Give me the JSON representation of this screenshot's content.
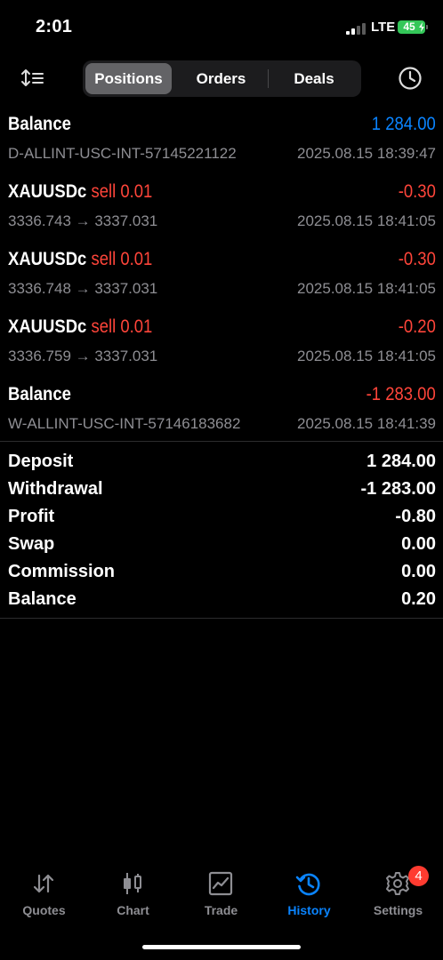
{
  "status_bar": {
    "time": "2:01",
    "network": "LTE",
    "battery": "45"
  },
  "tabs_top": [
    "Positions",
    "Orders",
    "Deals"
  ],
  "active_top_tab": "Positions",
  "deals": [
    {
      "l1": "Balance",
      "r1": "1 284.00",
      "l2": "D-ALLINT-USC-INT-57145221122",
      "r2": "2025.08.15 18:39:47",
      "kind": "balance",
      "color": "#0a84ff"
    },
    {
      "symbol": "XAUUSDc",
      "side": "sell 0.01",
      "r1": "-0.30",
      "l2": "3336.743 → 3337.031",
      "r2": "2025.08.15 18:41:05",
      "kind": "trade"
    },
    {
      "symbol": "XAUUSDc",
      "side": "sell 0.01",
      "r1": "-0.30",
      "l2": "3336.748 → 3337.031",
      "r2": "2025.08.15 18:41:05",
      "kind": "trade"
    },
    {
      "symbol": "XAUUSDc",
      "side": "sell 0.01",
      "r1": "-0.20",
      "l2": "3336.759 → 3337.031",
      "r2": "2025.08.15 18:41:05",
      "kind": "trade"
    },
    {
      "l1": "Balance",
      "r1": "-1 283.00",
      "l2": "W-ALLINT-USC-INT-57146183682",
      "r2": "2025.08.15 18:41:39",
      "kind": "balance",
      "color": "#ff453a"
    }
  ],
  "summary": [
    {
      "label": "Deposit",
      "value": "1 284.00"
    },
    {
      "label": "Withdrawal",
      "value": "-1 283.00"
    },
    {
      "label": "Profit",
      "value": "-0.80"
    },
    {
      "label": "Swap",
      "value": "0.00"
    },
    {
      "label": "Commission",
      "value": "0.00"
    },
    {
      "label": "Balance",
      "value": "0.20"
    }
  ],
  "bottom_tabs": [
    {
      "label": "Quotes",
      "icon": "quotes-icon"
    },
    {
      "label": "Chart",
      "icon": "chart-candles-icon"
    },
    {
      "label": "Trade",
      "icon": "trade-icon"
    },
    {
      "label": "History",
      "icon": "history-icon"
    },
    {
      "label": "Settings",
      "icon": "gear-icon"
    }
  ],
  "active_bottom_tab": "History",
  "settings_badge": "4",
  "colors": {
    "accent": "#0a84ff",
    "negative": "#ff453a",
    "secondary_text": "#8e8e93"
  }
}
